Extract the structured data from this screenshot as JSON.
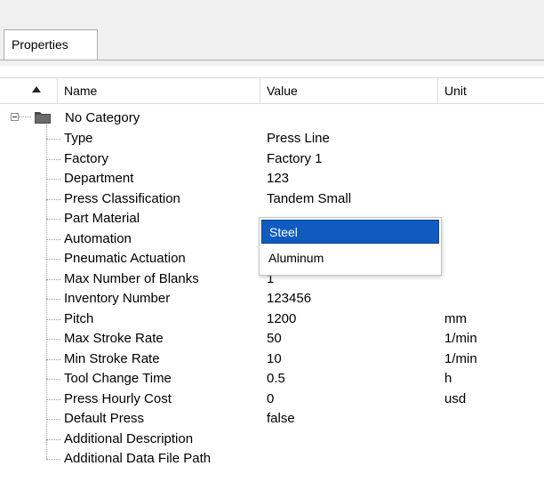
{
  "tab": {
    "label": "Properties"
  },
  "columns": {
    "name": "Name",
    "value": "Value",
    "unit": "Unit"
  },
  "category": {
    "label": "No Category"
  },
  "rows": [
    {
      "name": "Type",
      "value": "Press Line",
      "unit": ""
    },
    {
      "name": "Factory",
      "value": "Factory 1",
      "unit": ""
    },
    {
      "name": "Department",
      "value": "123",
      "unit": ""
    },
    {
      "name": "Press Classification",
      "value": "Tandem Small",
      "unit": ""
    },
    {
      "name": "Part Material",
      "value": "",
      "unit": ""
    },
    {
      "name": "Automation",
      "value": "",
      "unit": ""
    },
    {
      "name": "Pneumatic Actuation",
      "value": "",
      "unit": ""
    },
    {
      "name": "Max Number of Blanks",
      "value": "1",
      "unit": ""
    },
    {
      "name": "Inventory Number",
      "value": "123456",
      "unit": ""
    },
    {
      "name": "Pitch",
      "value": "1200",
      "unit": "mm"
    },
    {
      "name": "Max Stroke Rate",
      "value": "50",
      "unit": "1/min"
    },
    {
      "name": "Min Stroke Rate",
      "value": "10",
      "unit": "1/min"
    },
    {
      "name": "Tool Change Time",
      "value": "0.5",
      "unit": "h"
    },
    {
      "name": "Press Hourly Cost",
      "value": "0",
      "unit": "usd"
    },
    {
      "name": "Default Press",
      "value": "false",
      "unit": ""
    },
    {
      "name": "Additional Description",
      "value": "",
      "unit": ""
    },
    {
      "name": "Additional Data File Path",
      "value": "",
      "unit": ""
    }
  ],
  "dropdown": {
    "options": [
      "Steel",
      "Aluminum"
    ],
    "selected": "Steel"
  },
  "colors": {
    "selection": "#0f5bc2",
    "tab_bg": "#f0f0f0"
  },
  "icons": {
    "sort": "sort-up-icon",
    "folder": "folder-icon",
    "expander": "collapse-minus-icon"
  }
}
